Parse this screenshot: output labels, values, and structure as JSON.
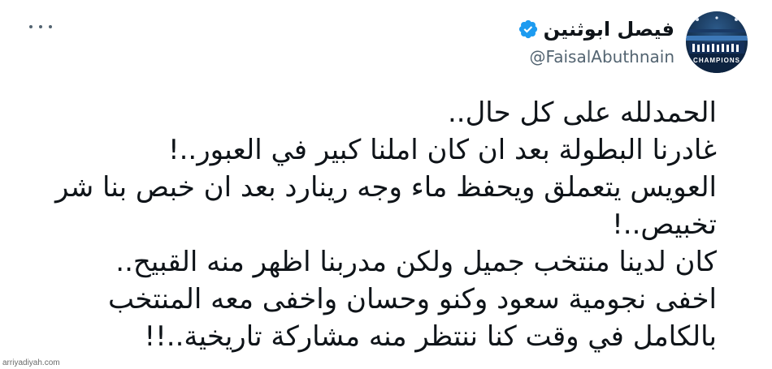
{
  "author": {
    "display_name": "فيصل ابوثنين",
    "handle": "@FaisalAbuthnain",
    "verified": true,
    "verified_color": "#1d9bf0",
    "avatar_caption": "CHAMPIONS"
  },
  "menu": {
    "icon": "more-horizontal-icon"
  },
  "tweet": {
    "lines": [
      "الحمدلله على كل حال..",
      "غادرنا البطولة بعد ان كان املنا كبير في العبور..!",
      "العويس يتعملق ويحفظ ماء وجه رينارد بعد ان خبص بنا شر",
      "تخبيص..!",
      "كان لدينا منتخب جميل ولكن مدربنا اظهر منه القبيح..",
      "اخفى نجومية سعود وكنو وحسان واخفى معه المنتخب",
      "بالكامل في وقت كنا ننتظر منه مشاركة تاريخية..!!"
    ]
  },
  "watermark": {
    "text": "arriyadiyah.com"
  },
  "colors": {
    "text_primary": "#0f1419",
    "text_secondary": "#536471",
    "background": "#ffffff"
  }
}
